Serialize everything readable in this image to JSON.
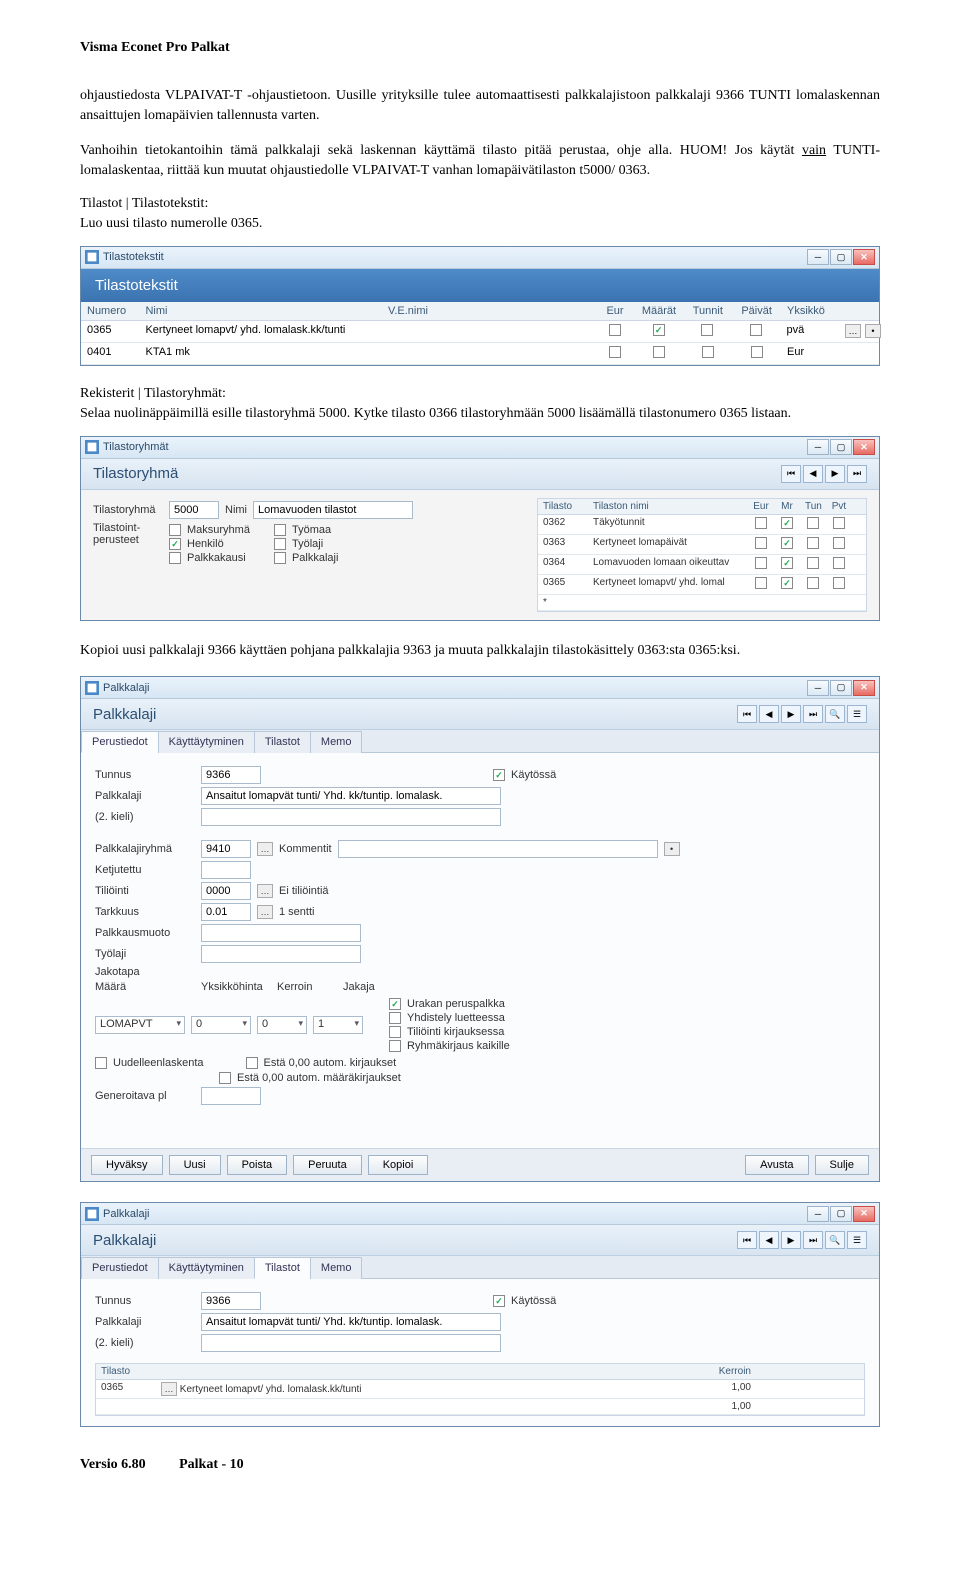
{
  "header": "Visma Econet Pro Palkat",
  "para1": "ohjaustiedosta VLPAIVAT-T -ohjaustietoon. Uusille yrityksille tulee automaattisesti palkkalajistoon palkkalaji 9366 TUNTI lomalaskennan ansaittujen lomapäivien tallennusta varten.",
  "para2a": "Vanhoihin tietokantoihin tämä palkkalaji sekä laskennan käyttämä tilasto pitää perustaa, ohje alla. HUOM! Jos käytät ",
  "para2u": "vain",
  "para2b": " TUNTI-lomalaskentaa, riittää kun muutat ohjaustiedolle VLPAIVAT-T vanhan lomapäivätilaston t5000/ 0363.",
  "sect1a": "Tilastot | Tilastotekstit:",
  "sect1b": "Luo uusi tilasto numerolle 0365.",
  "tt": {
    "wintitle": "Tilastotekstit",
    "paneltitle": "Tilastotekstit",
    "cols": {
      "num": "Numero",
      "nimi": "Nimi",
      "ven": "V.E.nimi",
      "eur": "Eur",
      "maar": "Määrät",
      "tun": "Tunnit",
      "pvt": "Päivät",
      "yks": "Yksikkö"
    },
    "rows": [
      {
        "num": "0365",
        "nimi": "Kertyneet lomapvt/ yhd. lomalask.kk/tunti",
        "ven": "",
        "eur": false,
        "maar": true,
        "tun": false,
        "pvt": false,
        "yks": "pvä"
      },
      {
        "num": "0401",
        "nimi": "KTA1 mk",
        "ven": "",
        "eur": false,
        "maar": false,
        "tun": false,
        "pvt": false,
        "yks": "Eur"
      }
    ]
  },
  "sect2": "Rekisterit | Tilastoryhmät:",
  "sect2b": "Selaa nuolinäppäimillä esille tilastoryhmä 5000. Kytke tilasto 0366 tilastoryhmään 5000 lisäämällä tilastonumero 0365 listaan.",
  "tr": {
    "wintitle": "Tilastoryhmät",
    "paneltitle": "Tilastoryhmä",
    "lbl_tr": "Tilastoryhmä",
    "val_tr": "5000",
    "lbl_nimi": "Nimi",
    "val_nimi": "Lomavuoden tilastot",
    "lbl_tp": "Tilastoint-\nperusteet",
    "chks_left": [
      {
        "l": "Maksuryhmä",
        "v": false
      },
      {
        "l": "Henkilö",
        "v": true
      },
      {
        "l": "Palkkakausi",
        "v": false
      }
    ],
    "chks_right": [
      {
        "l": "Työmaa",
        "v": false
      },
      {
        "l": "Työlaji",
        "v": false
      },
      {
        "l": "Palkkalaji",
        "v": false
      }
    ],
    "subcols": {
      "t": "Tilasto",
      "tn": "Tilaston nimi",
      "e": "Eur",
      "m": "Mr",
      "tu": "Tun",
      "pv": "Pvt"
    },
    "subrows": [
      {
        "t": "0362",
        "tn": "Täkyötunnit",
        "e": false,
        "m": true,
        "tu": false,
        "pv": false
      },
      {
        "t": "0363",
        "tn": "Kertyneet lomapäivät",
        "e": false,
        "m": true,
        "tu": false,
        "pv": false
      },
      {
        "t": "0364",
        "tn": "Lomavuoden lomaan oikeuttav",
        "e": false,
        "m": true,
        "tu": false,
        "pv": false
      },
      {
        "t": "0365",
        "tn": "Kertyneet lomapvt/ yhd. lomal",
        "e": false,
        "m": true,
        "tu": false,
        "pv": false
      },
      {
        "t": "*",
        "tn": "",
        "e": false,
        "m": false,
        "tu": false,
        "pv": false
      }
    ]
  },
  "sect3": "Kopioi uusi palkkalaji 9366 käyttäen pohjana palkkalajia 9363 ja muuta palkkalajin tilastokäsittely 0363:sta 0365:ksi.",
  "pl": {
    "wintitle": "Palkkalaji",
    "paneltitle": "Palkkalaji",
    "tabs": [
      "Perustiedot",
      "Käyttäytyminen",
      "Tilastot",
      "Memo"
    ],
    "active_tab": 0,
    "f": {
      "tunnus_l": "Tunnus",
      "tunnus": "9366",
      "kayt_l": "Käytössä",
      "kayt": true,
      "pl_l": "Palkkalaji",
      "pl": "Ansaitut lomapvät tunti/ Yhd. kk/tuntip. lomalask.",
      "kieli_l": "(2. kieli)",
      "kieli": "",
      "plr_l": "Palkkalajiryhmä",
      "plr": "9410",
      "komm_l": "Kommentit",
      "komm": "",
      "ketj_l": "Ketjutettu",
      "ketj": "",
      "til_l": "Tiliöinti",
      "til": "0000",
      "til2": "Ei tiliöintiä",
      "tark_l": "Tarkkuus",
      "tark": "0.01",
      "tark2": "1 sentti",
      "pkm_l": "Palkkausmuoto",
      "pkm": "",
      "tyol_l": "Työlaji",
      "tyol": "",
      "jak_l": "Jakotapa",
      "jak": "",
      "maara_l": "Määrä",
      "yks_l": "Yksikköhinta",
      "ker_l": "Kerroin",
      "jakaja_l": "Jakaja",
      "maara": "LOMAPVT",
      "yks": "0",
      "ker": "0",
      "jakaja": "1",
      "r_urak": "Urakan peruspalkka",
      "r_yhd": "Yhdistely luetteessa",
      "r_til": "Tiliöinti kirjauksessa",
      "r_ryh": "Ryhmäkirjaus kaikille",
      "uud": "Uudelleenlaskenta",
      "est1": "Estä 0,00 autom. kirjaukset",
      "est2": "Estä 0,00 autom. määräkirjaukset",
      "gen_l": "Generoitava pl"
    },
    "buttons": [
      "Hyväksy",
      "Uusi",
      "Poista",
      "Peruuta",
      "Kopioi",
      "Avusta",
      "Sulje"
    ]
  },
  "pl2": {
    "wintitle": "Palkkalaji",
    "paneltitle": "Palkkalaji",
    "active_tab": 2,
    "f": {
      "tunnus_l": "Tunnus",
      "tunnus": "9366",
      "kayt_l": "Käytössä",
      "kayt": true,
      "pl_l": "Palkkalaji",
      "pl": "Ansaitut lomapvät tunti/ Yhd. kk/tuntip. lomalask.",
      "kieli_l": "(2. kieli)",
      "kieli": ""
    },
    "tcols": {
      "t": "Tilasto",
      "n": "",
      "k": "Kerroin"
    },
    "trows": [
      {
        "t": "0365",
        "n": "Kertyneet lomapvt/ yhd. lomalask.kk/tunti",
        "k": "1,00"
      },
      {
        "t": "",
        "n": "",
        "k": "1,00"
      }
    ]
  },
  "footer": {
    "ver": "Versio 6.80",
    "page": "Palkat - 10"
  }
}
